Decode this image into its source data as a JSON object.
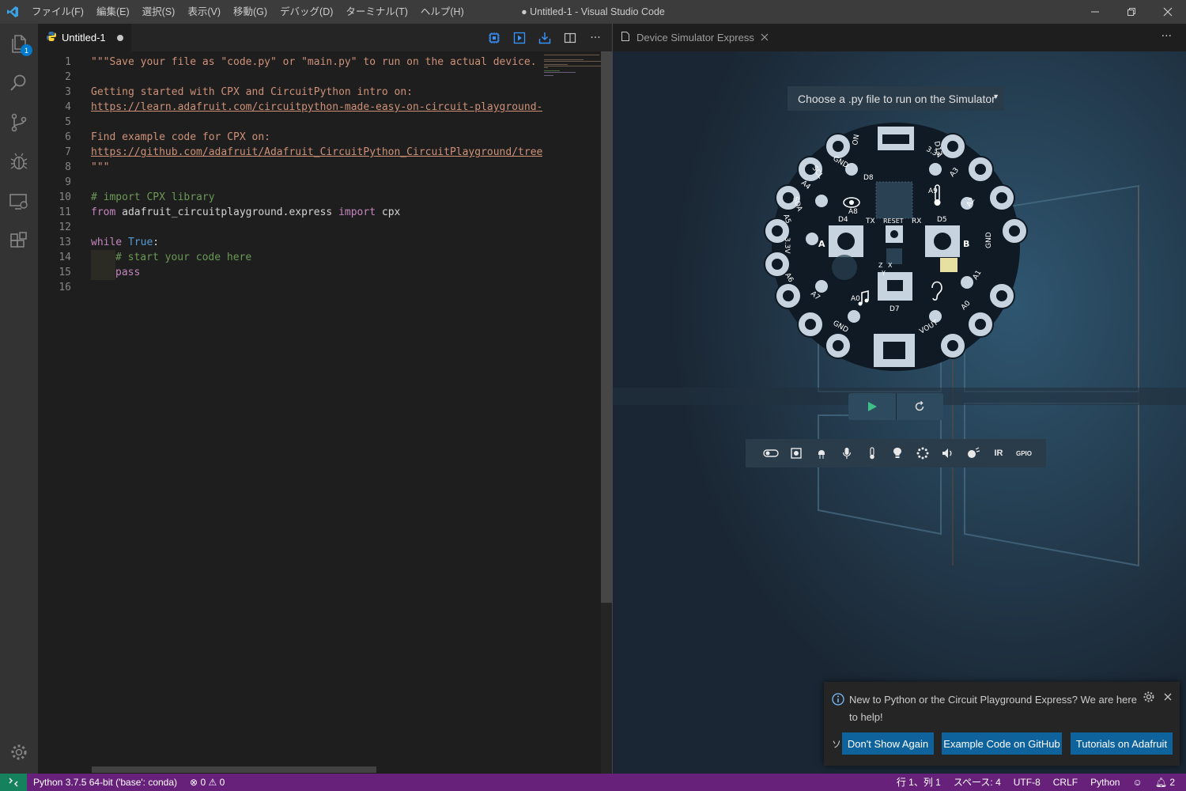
{
  "titlebar": {
    "menu": [
      "ファイル(F)",
      "編集(E)",
      "選択(S)",
      "表示(V)",
      "移動(G)",
      "デバッグ(D)",
      "ターミナル(T)",
      "ヘルプ(H)"
    ],
    "window_title": "● Untitled-1 - Visual Studio Code"
  },
  "activitybar": {
    "items": [
      "explorer-icon",
      "search-icon",
      "source-control-icon",
      "debug-icon",
      "remote-explorer-icon",
      "extensions-icon"
    ],
    "explorer_badge": "1"
  },
  "editor": {
    "tab_label": "Untitled-1",
    "lines": [
      {
        "n": "1",
        "text": "\"\"\"Save your file as \"code.py\" or \"main.py\" to run on the actual device."
      },
      {
        "n": "2",
        "text": ""
      },
      {
        "n": "3",
        "text": "Getting started with CPX and CircuitPython intro on:"
      },
      {
        "n": "4",
        "text": "https://learn.adafruit.com/circuitpython-made-easy-on-circuit-playground-e"
      },
      {
        "n": "5",
        "text": ""
      },
      {
        "n": "6",
        "text": "Find example code for CPX on:"
      },
      {
        "n": "7",
        "text": "https://github.com/adafruit/Adafruit_CircuitPython_CircuitPlayground/tree/"
      },
      {
        "n": "8",
        "text": "\"\"\""
      },
      {
        "n": "9",
        "text": ""
      },
      {
        "n": "10",
        "text": "# import CPX library"
      },
      {
        "n": "11a",
        "text": "from"
      },
      {
        "n": "11b",
        "text": " adafruit_circuitplayground.express "
      },
      {
        "n": "11c",
        "text": "import"
      },
      {
        "n": "11d",
        "text": " cpx"
      },
      {
        "n": "12",
        "text": ""
      },
      {
        "n": "13a",
        "text": "while"
      },
      {
        "n": "13b",
        "text": "True"
      },
      {
        "n": "13c",
        "text": ":"
      },
      {
        "n": "14",
        "text": "# start your code here"
      },
      {
        "n": "15",
        "text": "pass"
      },
      {
        "n": "16",
        "text": ""
      }
    ],
    "line_numbers": [
      "1",
      "2",
      "3",
      "4",
      "5",
      "6",
      "7",
      "8",
      "9",
      "10",
      "11",
      "12",
      "13",
      "14",
      "15",
      "16"
    ]
  },
  "simulator": {
    "tab_label": "Device Simulator Express",
    "file_select": "Choose a .py file to run on the Simulator",
    "board_labels": {
      "d13": "D13",
      "d8": "D8",
      "a9": "A9",
      "a8": "A8",
      "d4": "D4",
      "d5": "D5",
      "tx": "TX",
      "rx": "RX",
      "reset": "RESET",
      "a0": "A0",
      "d7": "D7",
      "gnd": "GND",
      "scl": "SCL",
      "sda": "SDA",
      "a4": "A4",
      "a5": "A5",
      "a6": "A6",
      "a7": "A7",
      "a1": "A1",
      "a2": "A2",
      "a3": "A3",
      "v33": "3.3V",
      "vout": "VOUT",
      "on": "ON",
      "btn_a": "A",
      "btn_b": "B",
      "axis_y": "Y",
      "axis_z": "Z",
      "axis_x": "X"
    },
    "toolbar_items": [
      "switch-icon",
      "button-icon",
      "led-icon",
      "microphone-icon",
      "thermometer-icon",
      "light-icon",
      "neopixel-icon",
      "speaker-icon",
      "motion-icon",
      "IR",
      "GPIO"
    ]
  },
  "notification": {
    "message": "New to Python or the Circuit Playground Express? We are here to help!",
    "source": "ソ",
    "buttons": [
      "Don't Show Again",
      "Example Code on GitHub",
      "Tutorials on Adafruit"
    ]
  },
  "statusbar": {
    "interpreter": "Python 3.7.5 64-bit ('base': conda)",
    "errors": "0",
    "warnings": "0",
    "position": "行 1、列 1",
    "spaces": "スペース: 4",
    "encoding": "UTF-8",
    "eol": "CRLF",
    "language": "Python",
    "notifications": "2"
  },
  "colors": {
    "statusbar": "#68217a",
    "accent": "#007acc",
    "button": "#0e639c"
  }
}
